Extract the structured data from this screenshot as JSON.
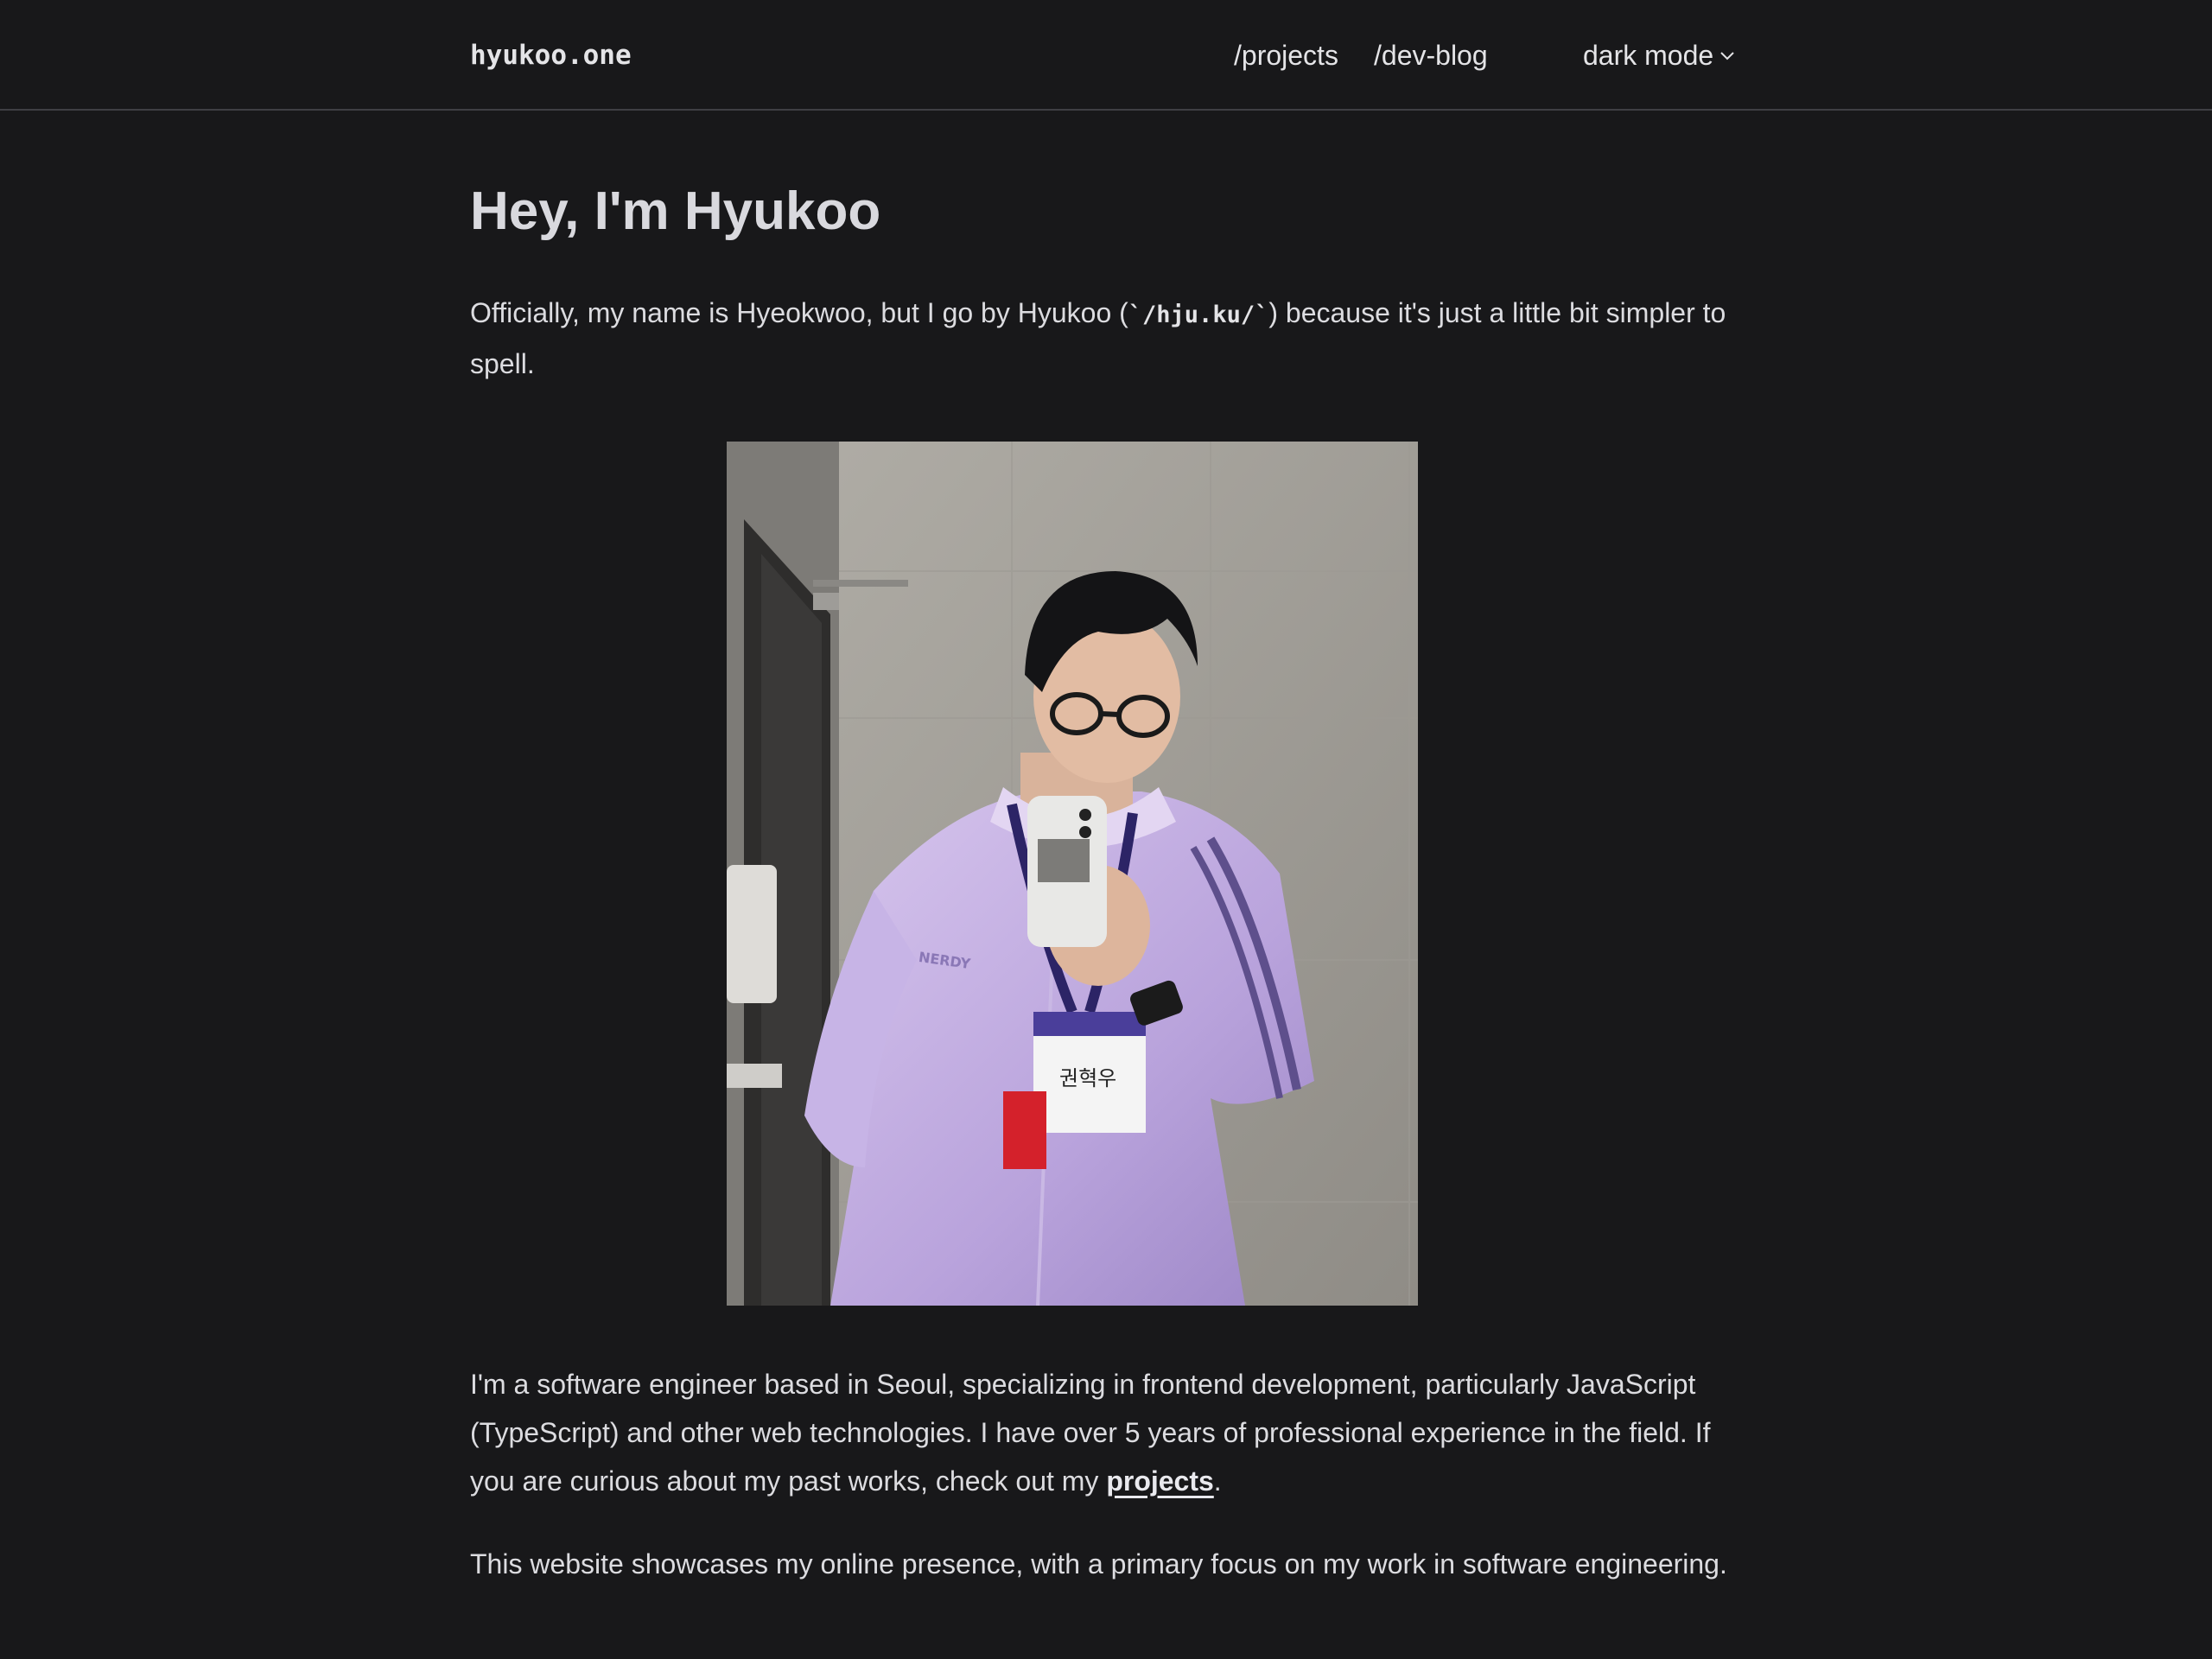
{
  "header": {
    "logo": "hyukoo.one",
    "nav": [
      {
        "label": "/projects"
      },
      {
        "label": "/dev-blog"
      }
    ],
    "theme_toggle": {
      "label": "dark mode",
      "icon": "chevron-down-icon"
    }
  },
  "main": {
    "title": "Hey, I'm Hyukoo",
    "intro": {
      "before": "Officially, my name is Hyeokwoo, but I go by Hyukoo (",
      "code": "`/hju.ku/`",
      "after": ") because it's just a little bit simpler to spell."
    },
    "photo": {
      "badge_text": "권혁우",
      "jacket_text": "NERDY"
    },
    "about": {
      "before": "I'm a software engineer based in Seoul, specializing in frontend development, particularly JavaScript (TypeScript) and other web technologies. I have over 5 years of professional experience in the field. If you are curious about my past works, check out my ",
      "link": "projects",
      "after": "."
    },
    "site": "This website showcases my online presence, with a primary focus on my work in software engineering."
  },
  "colors": {
    "background": "#18181a",
    "text": "#e4e4e7",
    "divider": "#3f3f44"
  }
}
